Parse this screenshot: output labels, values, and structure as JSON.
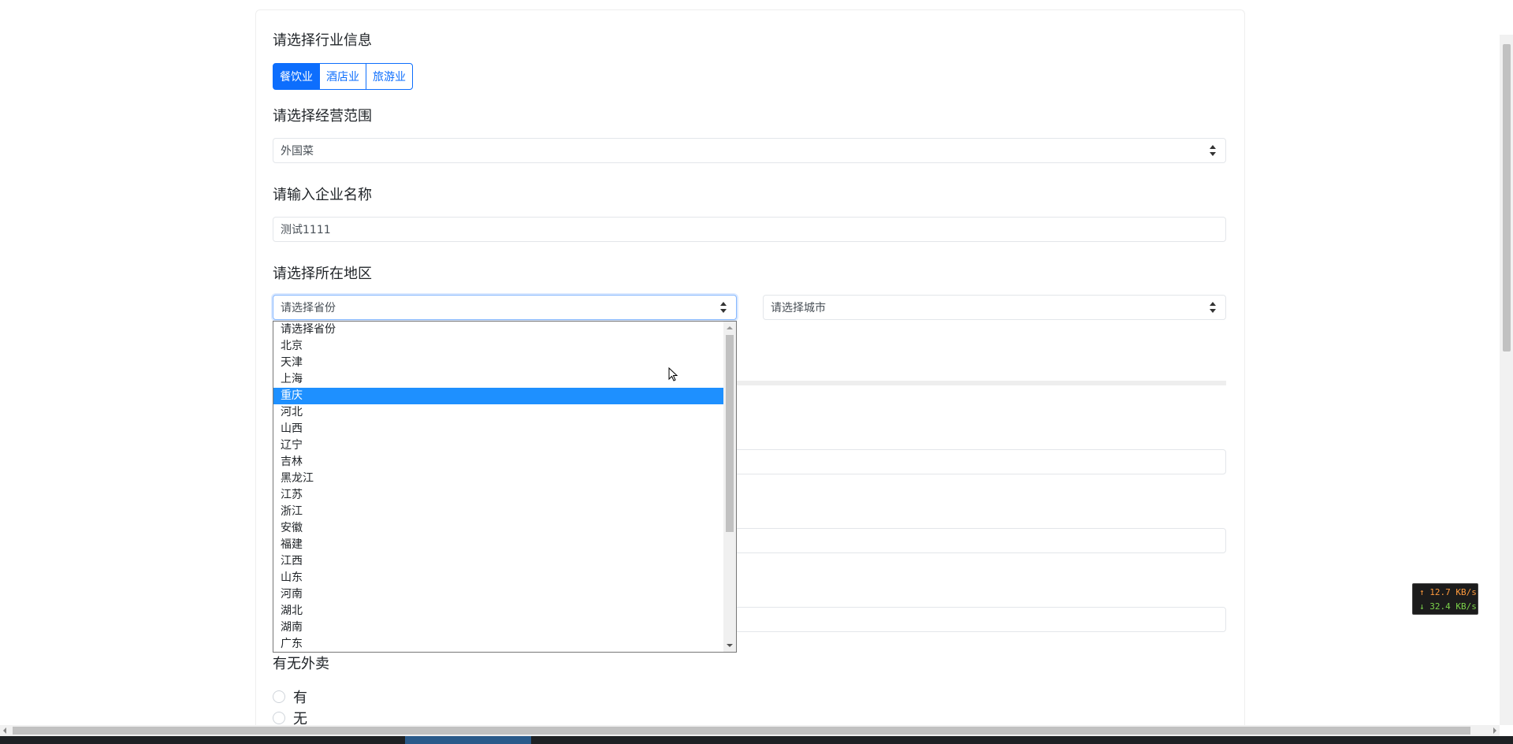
{
  "form": {
    "industry_label": "请选择行业信息",
    "industry_options": [
      "餐饮业",
      "酒店业",
      "旅游业"
    ],
    "industry_selected": "餐饮业",
    "scope_label": "请选择经营范围",
    "scope_value": "外国菜",
    "company_label": "请输入企业名称",
    "company_value": "测试1111",
    "region_label": "请选择所在地区",
    "province_value": "请选择省份",
    "city_value": "请选择城市",
    "takeaway_label": "有无外卖",
    "takeaway_options": [
      "有",
      "无"
    ]
  },
  "province_dropdown": {
    "options": [
      "请选择省份",
      "北京",
      "天津",
      "上海",
      "重庆",
      "河北",
      "山西",
      "辽宁",
      "吉林",
      "黑龙江",
      "江苏",
      "浙江",
      "安徽",
      "福建",
      "江西",
      "山东",
      "河南",
      "湖北",
      "湖南",
      "广东"
    ],
    "highlighted": "重庆"
  },
  "netspeed": {
    "up": "↑ 12.7 KB/s",
    "down": "↓ 32.4 KB/s"
  },
  "colors": {
    "primary": "#0d6efd",
    "highlight": "#1e90ff"
  }
}
